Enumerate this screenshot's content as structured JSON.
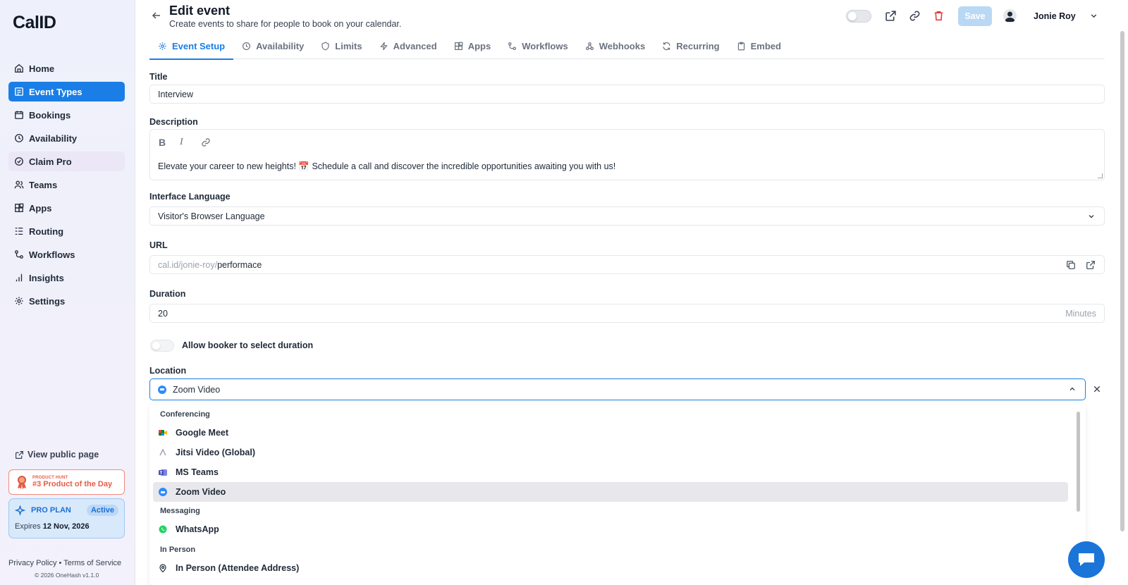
{
  "brand": {
    "logo": "CalID"
  },
  "sidebar": {
    "items": [
      {
        "label": "Home",
        "icon": "home-icon"
      },
      {
        "label": "Event Types",
        "icon": "event-types-icon",
        "active": true
      },
      {
        "label": "Bookings",
        "icon": "calendar-icon"
      },
      {
        "label": "Availability",
        "icon": "clock-icon"
      },
      {
        "label": "Claim Pro",
        "icon": "badge-icon"
      },
      {
        "label": "Teams",
        "icon": "users-icon"
      },
      {
        "label": "Apps",
        "icon": "apps-icon"
      },
      {
        "label": "Routing",
        "icon": "routing-icon"
      },
      {
        "label": "Workflows",
        "icon": "workflows-icon"
      },
      {
        "label": "Insights",
        "icon": "bar-chart-icon"
      },
      {
        "label": "Settings",
        "icon": "gear-icon"
      }
    ],
    "view_public": "View public page",
    "product_hunt": {
      "small": "PRODUCT HUNT",
      "big": "#3 Product of the Day"
    },
    "plan": {
      "name": "PRO PLAN",
      "status": "Active",
      "expires_label": "Expires",
      "expires_date": "12 Nov, 2026"
    },
    "footer": {
      "links": "Privacy Policy • Terms of Service",
      "copyright": "© 2026 OneHash v1.1.0"
    }
  },
  "header": {
    "title": "Edit event",
    "subtitle": "Create events to share for people to book on your calendar.",
    "save_label": "Save",
    "user_name": "Jonie Roy"
  },
  "tabs": [
    {
      "label": "Event Setup",
      "icon": "gear-icon",
      "active": true
    },
    {
      "label": "Availability",
      "icon": "clock-icon"
    },
    {
      "label": "Limits",
      "icon": "shield-icon"
    },
    {
      "label": "Advanced",
      "icon": "bolt-icon"
    },
    {
      "label": "Apps",
      "icon": "apps-icon"
    },
    {
      "label": "Workflows",
      "icon": "workflows-icon"
    },
    {
      "label": "Webhooks",
      "icon": "webhook-icon"
    },
    {
      "label": "Recurring",
      "icon": "refresh-icon"
    },
    {
      "label": "Embed",
      "icon": "clipboard-icon"
    }
  ],
  "form": {
    "title_label": "Title",
    "title_value": "Interview",
    "description_label": "Description",
    "description_value": "Elevate your career to new heights! 📅 Schedule a call and discover the incredible opportunities awaiting you with us!",
    "language_label": "Interface Language",
    "language_value": "Visitor's Browser Language",
    "url_label": "URL",
    "url_prefix": "cal.id/jonie-roy/",
    "url_slug": "performace",
    "duration_label": "Duration",
    "duration_value": "20",
    "duration_unit": "Minutes",
    "allow_duration_label": "Allow booker to select duration",
    "location_label": "Location",
    "location_value": "Zoom Video"
  },
  "location_dropdown": {
    "groups": [
      {
        "label": "Conferencing",
        "options": [
          "Google Meet",
          "Jitsi Video (Global)",
          "MS Teams",
          "Zoom Video"
        ]
      },
      {
        "label": "Messaging",
        "options": [
          "WhatsApp"
        ]
      },
      {
        "label": "In Person",
        "options": [
          "In Person (Attendee Address)"
        ]
      }
    ],
    "selected": "Zoom Video"
  },
  "colors": {
    "accent": "#1a7ee6",
    "danger": "#e53e3e",
    "product_hunt": "#e65c47"
  }
}
